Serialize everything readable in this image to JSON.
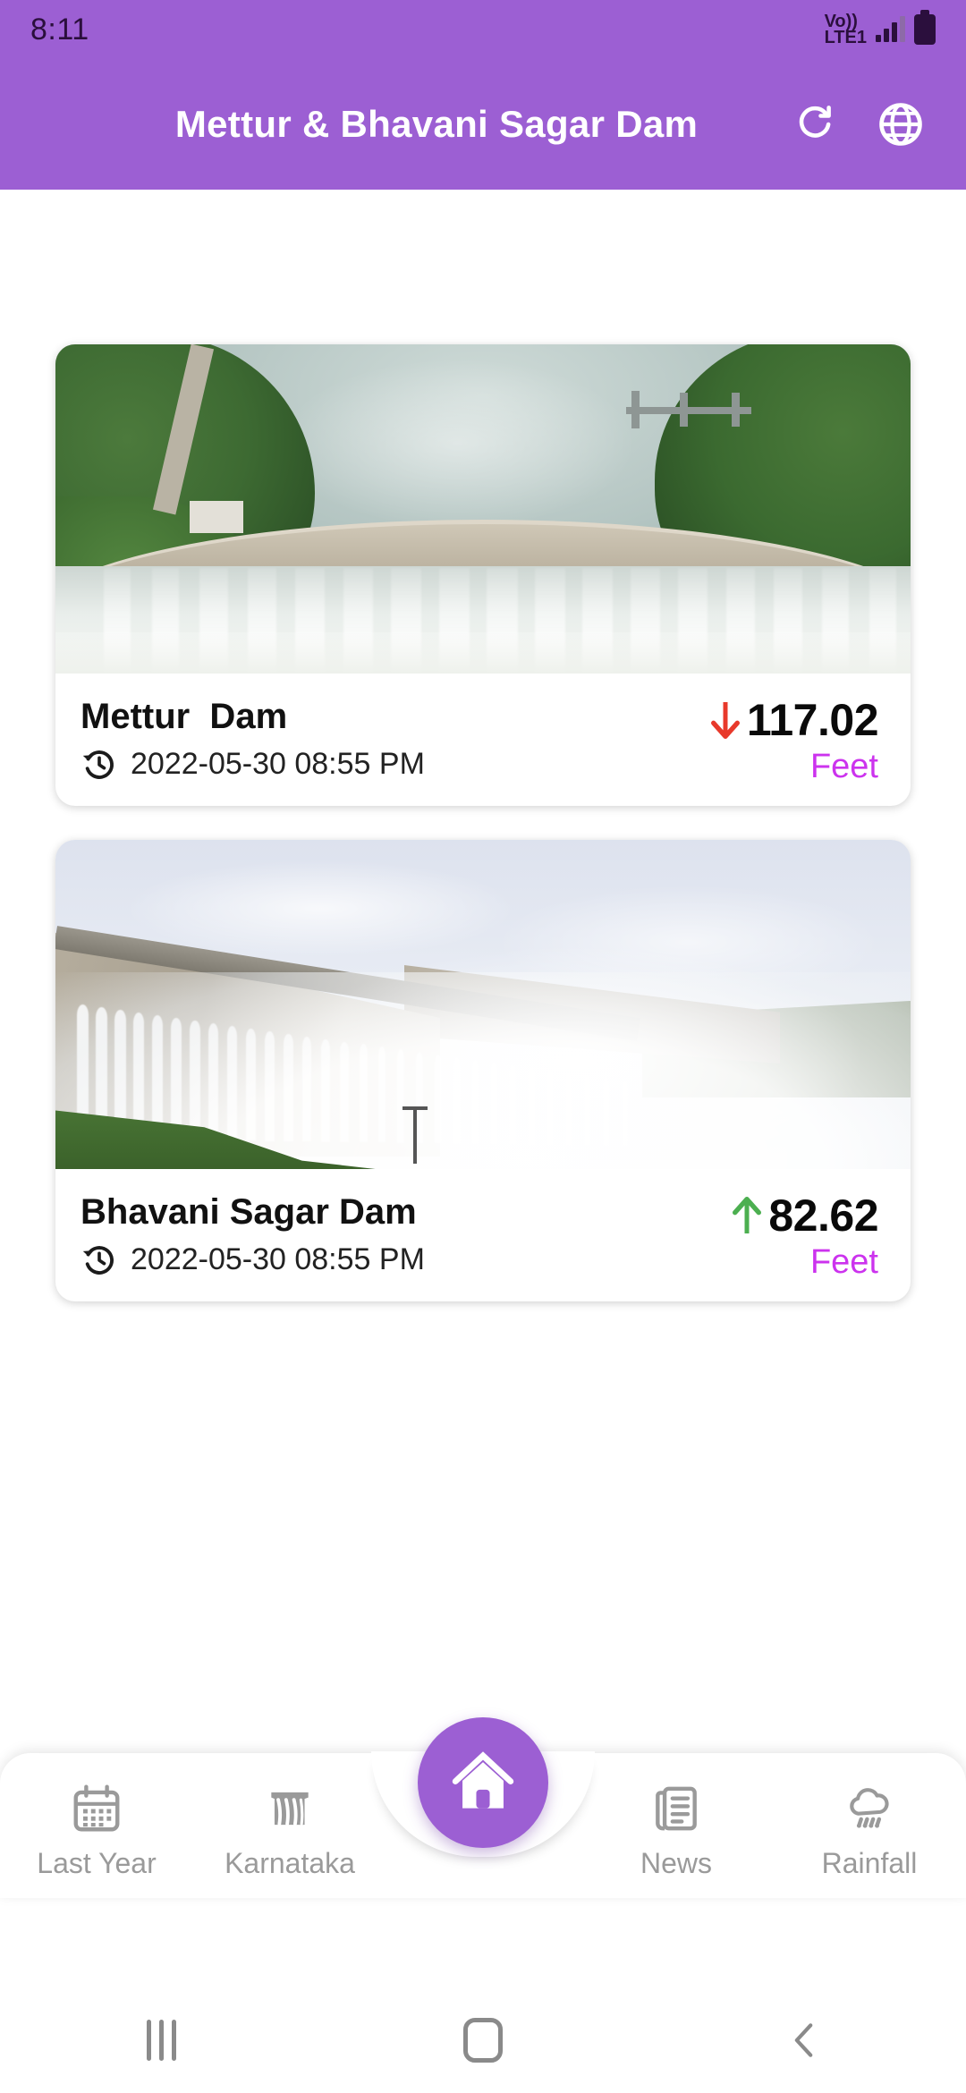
{
  "status_bar": {
    "time": "8:11",
    "network_line1": "Vo))",
    "network_line2": "LTE1",
    "signal_icon": "signal-bars-icon",
    "battery_icon": "battery-full-icon"
  },
  "app_bar": {
    "title": "Mettur & Bhavani Sagar Dam",
    "refresh_icon": "refresh-icon",
    "language_icon": "globe-icon",
    "background_color": "#9C5FD3"
  },
  "dams": [
    {
      "name": "Mettur  Dam",
      "photo_alt": "aerial-view-of-mettur-dam-spillway",
      "clock_icon": "history-icon",
      "timestamp": "2022-05-30 08:55 PM",
      "level": "117.02",
      "unit": "Feet",
      "trend": "down",
      "trend_icon": "arrow-down-icon",
      "trend_color": "#E8392B"
    },
    {
      "name": "Bhavani Sagar Dam",
      "photo_alt": "bhavani-sagar-dam-spillway-discharge",
      "clock_icon": "history-icon",
      "timestamp": "2022-05-30 08:55 PM",
      "level": "82.62",
      "unit": "Feet",
      "trend": "up",
      "trend_icon": "arrow-up-icon",
      "trend_color": "#4CAF50"
    }
  ],
  "bottom_nav": {
    "items": [
      {
        "label": "Last Year",
        "icon": "calendar-icon"
      },
      {
        "label": "Karnataka",
        "icon": "dam-icon"
      },
      {
        "label": "News",
        "icon": "article-icon"
      },
      {
        "label": "Rainfall",
        "icon": "rain-cloud-icon"
      }
    ],
    "fab": {
      "icon": "home-icon",
      "color": "#9C5FD3"
    }
  },
  "system_nav": {
    "recents_icon": "recents-icon",
    "home_icon": "home-square-icon",
    "back_icon": "back-chevron-icon"
  },
  "theme": {
    "accent": "#9C5FD3",
    "unit_color": "#CC33EE",
    "up_color": "#4CAF50",
    "down_color": "#E8392B"
  }
}
